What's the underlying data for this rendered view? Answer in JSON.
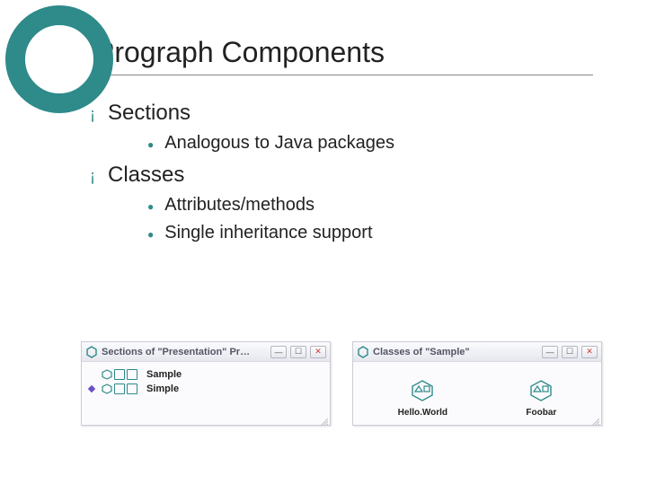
{
  "title": "Prograph Components",
  "bullets": {
    "sections": {
      "label": "Sections",
      "sub": [
        "Analogous to Java packages"
      ]
    },
    "classes": {
      "label": "Classes",
      "sub": [
        "Attributes/methods",
        "Single inheritance support"
      ]
    }
  },
  "windows": {
    "sections_window": {
      "title": "Sections of \"Presentation\" Pr…",
      "items": [
        {
          "label": "Sample",
          "marked": false
        },
        {
          "label": "Simple",
          "marked": true
        }
      ]
    },
    "classes_window": {
      "title": "Classes of \"Sample\"",
      "items": [
        {
          "label": "Hello.World"
        },
        {
          "label": "Foobar"
        }
      ]
    }
  }
}
